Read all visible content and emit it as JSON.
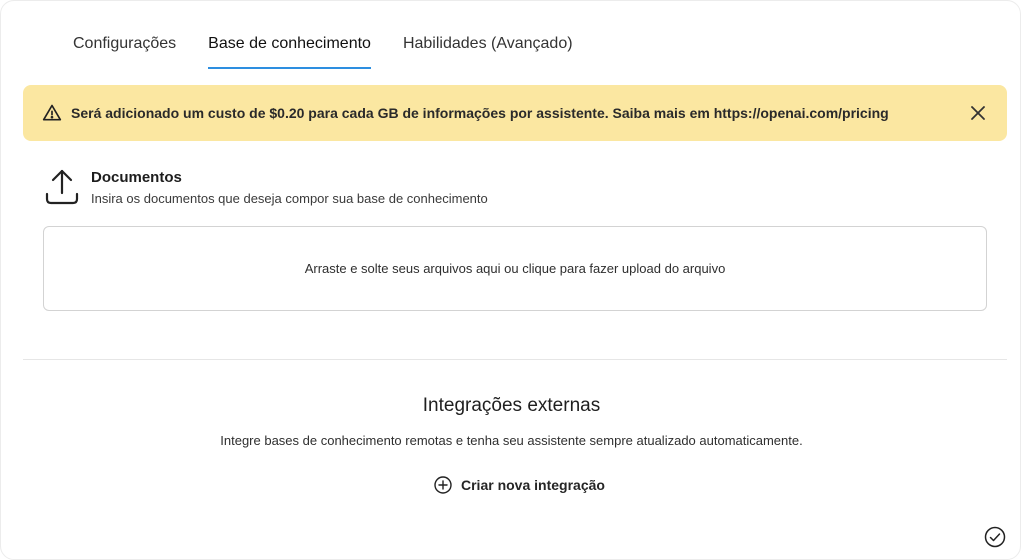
{
  "tabs": [
    {
      "label": "Configurações",
      "active": false
    },
    {
      "label": "Base de conhecimento",
      "active": true
    },
    {
      "label": "Habilidades (Avançado)",
      "active": false
    }
  ],
  "alert": {
    "message": "Será adicionado um custo de $0.20 para cada GB de informações por assistente. Saiba mais em https://openai.com/pricing",
    "icon": "warning-icon",
    "close_icon": "close-icon",
    "background": "#fbe7a1"
  },
  "documents": {
    "icon": "upload-icon",
    "title": "Documentos",
    "description": "Insira os documentos que deseja compor sua base de conhecimento",
    "dropzone_text": "Arraste e solte seus arquivos aqui ou clique para fazer upload do arquivo"
  },
  "integrations": {
    "title": "Integrações externas",
    "description": "Integre bases de conhecimento remotas e tenha seu assistente sempre atualizado automaticamente.",
    "create_label": "Criar nova integração",
    "create_icon": "plus-circle-icon"
  },
  "footer": {
    "icon": "check-circle-icon"
  },
  "colors": {
    "accent": "#2d8ee0"
  }
}
